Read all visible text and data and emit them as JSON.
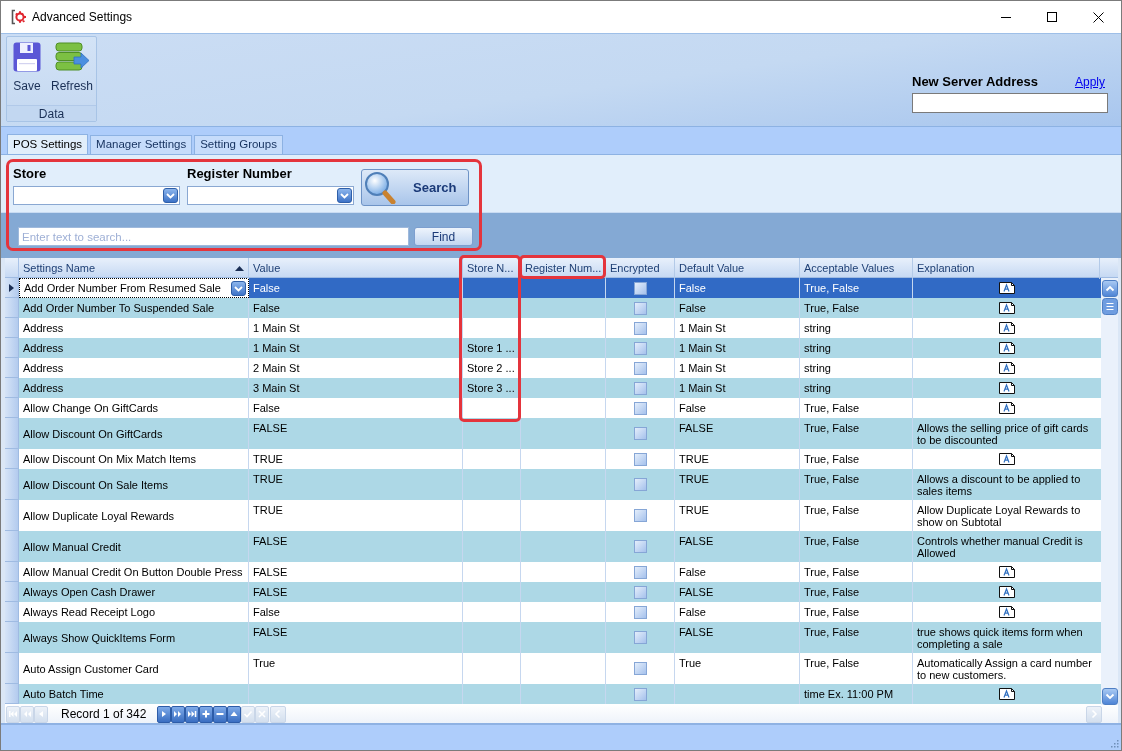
{
  "window": {
    "title": "Advanced Settings"
  },
  "ribbon": {
    "groups": [
      {
        "caption": "Data",
        "buttons": [
          {
            "kind": "save",
            "label": "Save"
          },
          {
            "kind": "refresh",
            "label": "Refresh"
          }
        ]
      }
    ],
    "server_address": {
      "label": "New Server Address",
      "link": "Apply"
    }
  },
  "tabs": [
    {
      "label": "POS Settings",
      "selected": true
    },
    {
      "label": "Manager Settings",
      "selected": false
    },
    {
      "label": "Setting Groups",
      "selected": false
    }
  ],
  "filter_panel": {
    "highlighted": true,
    "store": {
      "label": "Store"
    },
    "register": {
      "label": "Register Number"
    },
    "search_button": "Search",
    "text_search": {
      "placeholder": "Enter text to search...",
      "button": "Find"
    }
  },
  "table": {
    "columns": [
      {
        "label": "Settings Name",
        "sorted_ascending": true,
        "header_highlighted": false,
        "column_highlighted": false
      },
      {
        "label": "Value",
        "sorted_ascending": false,
        "header_highlighted": false,
        "column_highlighted": false
      },
      {
        "label": "Store N...",
        "sorted_ascending": false,
        "header_highlighted": false,
        "column_highlighted": true
      },
      {
        "label": "Register Num...",
        "sorted_ascending": false,
        "header_highlighted": true,
        "column_highlighted": false
      },
      {
        "label": "Encrypted",
        "sorted_ascending": false,
        "header_highlighted": false,
        "column_highlighted": false
      },
      {
        "label": "Default Value",
        "sorted_ascending": false,
        "header_highlighted": false,
        "column_highlighted": false
      },
      {
        "label": "Acceptable Values",
        "sorted_ascending": false,
        "header_highlighted": false,
        "column_highlighted": false
      },
      {
        "label": "Explanation",
        "sorted_ascending": false,
        "header_highlighted": false,
        "column_highlighted": false
      }
    ],
    "rows": [
      {
        "name": "Add Order Number From Resumed Sale",
        "value": "False",
        "encrypted": false,
        "default": "False",
        "acceptable": "True, False",
        "selected": true
      },
      {
        "name": "Add Order Number To Suspended Sale",
        "value": "False",
        "encrypted": false,
        "default": "False",
        "acceptable": "True, False",
        "selected": false
      },
      {
        "name": "Address",
        "value": "1 Main St",
        "encrypted": false,
        "default": "1 Main St",
        "acceptable": "string",
        "selected": false
      },
      {
        "name": "Address",
        "value": "1 Main St",
        "store": "Store 1 ...",
        "encrypted": false,
        "default": "1 Main St",
        "acceptable": "string",
        "selected": false
      },
      {
        "name": "Address",
        "value": "2 Main St",
        "store": "Store 2 ...",
        "encrypted": false,
        "default": "1 Main St",
        "acceptable": "string",
        "selected": false
      },
      {
        "name": "Address",
        "value": "3 Main St",
        "store": "Store 3 ...",
        "encrypted": false,
        "default": "1 Main St",
        "acceptable": "string",
        "selected": false
      },
      {
        "name": "Allow Change On GiftCards",
        "value": "False",
        "encrypted": false,
        "default": "False",
        "acceptable": "True, False",
        "selected": false
      },
      {
        "name": "Allow Discount On GiftCards",
        "value": "FALSE",
        "encrypted": false,
        "default": "FALSE",
        "acceptable": "True, False",
        "explanation": "Allows the selling price of gift cards to be discounted",
        "selected": false
      },
      {
        "name": "Allow Discount On Mix Match Items",
        "value": "TRUE",
        "encrypted": false,
        "default": "TRUE",
        "acceptable": "True, False",
        "selected": false
      },
      {
        "name": "Allow Discount On Sale Items",
        "value": "TRUE",
        "encrypted": false,
        "default": "TRUE",
        "acceptable": "True, False",
        "explanation": "Allows a discount to be applied to sales items",
        "selected": false
      },
      {
        "name": "Allow Duplicate Loyal Rewards",
        "value": "TRUE",
        "encrypted": false,
        "default": "TRUE",
        "acceptable": "True, False",
        "explanation": "Allow Duplicate Loyal Rewards to show on Subtotal",
        "selected": false
      },
      {
        "name": "Allow Manual Credit",
        "value": "FALSE",
        "encrypted": false,
        "default": "FALSE",
        "acceptable": "True, False",
        "explanation": "Controls whether manual Credit is Allowed",
        "selected": false
      },
      {
        "name": "Allow Manual Credit On Button Double Press",
        "value": "FALSE",
        "encrypted": false,
        "default": "False",
        "acceptable": "True, False",
        "selected": false
      },
      {
        "name": "Always Open Cash Drawer",
        "value": "FALSE",
        "encrypted": false,
        "default": "FALSE",
        "acceptable": "True, False",
        "selected": false
      },
      {
        "name": "Always Read Receipt Logo",
        "value": "False",
        "encrypted": false,
        "default": "False",
        "acceptable": "True, False",
        "selected": false
      },
      {
        "name": "Always Show QuickItems Form",
        "value": "FALSE",
        "encrypted": false,
        "default": "FALSE",
        "acceptable": "True, False",
        "explanation": "true shows quick items form when completing a sale",
        "selected": false
      },
      {
        "name": "Auto Assign Customer Card",
        "value": "True",
        "encrypted": false,
        "default": "True",
        "acceptable": "True, False",
        "explanation": "Automatically Assign a card number to new customers.",
        "selected": false
      },
      {
        "name": "Auto Batch Time",
        "encrypted": false,
        "acceptable": "time Ex. 11:00 PM",
        "selected": false
      }
    ]
  },
  "navigator": {
    "record": "Record 1 of 342",
    "buttons": [
      {
        "kind": "first",
        "disabled": true
      },
      {
        "kind": "prev_page",
        "disabled": true
      },
      {
        "kind": "prev",
        "disabled": true
      },
      {
        "kind": "next",
        "disabled": false
      },
      {
        "kind": "next_page",
        "disabled": false
      },
      {
        "kind": "last",
        "disabled": false
      },
      {
        "kind": "append",
        "disabled": false
      },
      {
        "kind": "remove",
        "disabled": false
      },
      {
        "kind": "edit",
        "disabled": false
      },
      {
        "kind": "end_edit",
        "disabled": true
      },
      {
        "kind": "cancel",
        "disabled": true
      }
    ],
    "scroll_buttons": [
      {
        "kind": "left",
        "disabled": true
      },
      {
        "kind": "right",
        "disabled": true
      }
    ]
  }
}
